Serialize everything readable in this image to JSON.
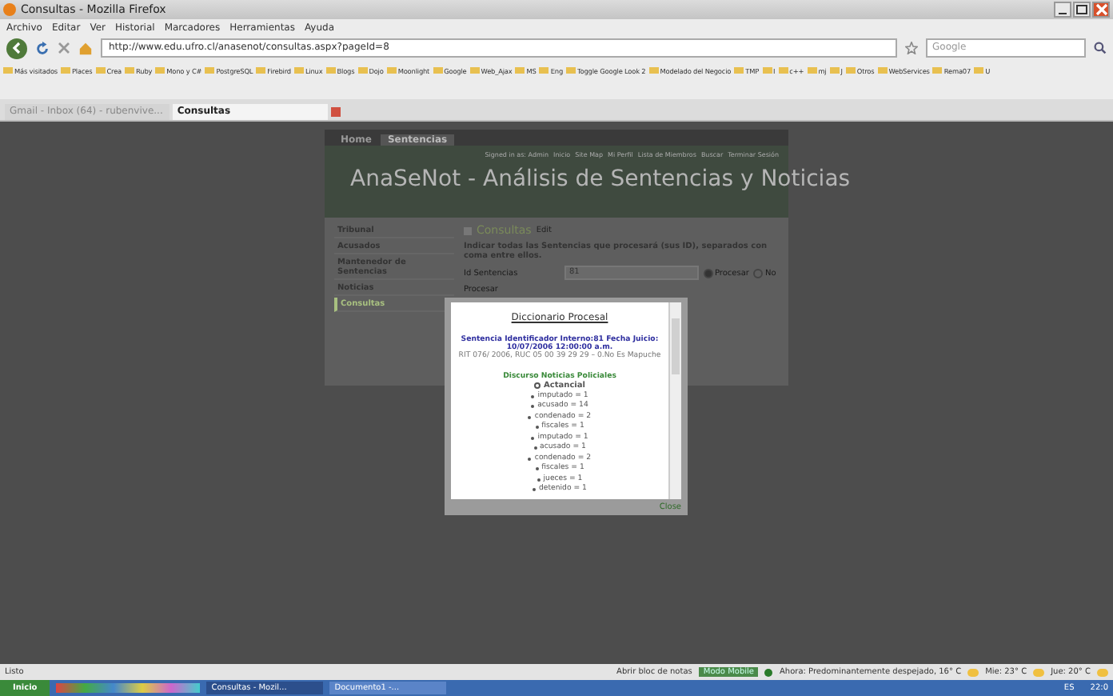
{
  "window": {
    "title": "Consultas - Mozilla Firefox"
  },
  "menu": [
    "Archivo",
    "Editar",
    "Ver",
    "Historial",
    "Marcadores",
    "Herramientas",
    "Ayuda"
  ],
  "toolbar": {
    "url": "http://www.edu.ufro.cl/anasenot/consultas.aspx?pageId=8",
    "search_placeholder": "Google"
  },
  "bookmarks": [
    "Más visitados",
    "Places",
    "Crea",
    "Ruby",
    "Mono y C#",
    "PostgreSQL",
    "Firebird",
    "Linux",
    "Blogs",
    "Dojo",
    "Moonlight",
    "Google",
    "Web_Ajax",
    "MS",
    "Eng",
    "Toggle Google Look 2",
    "Modelado del Negocio",
    "TMP",
    "I",
    "c++",
    "mj",
    "J",
    "Otros",
    "WebServices",
    "Rema07",
    "U"
  ],
  "tabs": [
    {
      "label": "Gmail - Inbox (64) - rubenvive...",
      "selected": false
    },
    {
      "label": "Consultas",
      "selected": true
    }
  ],
  "page": {
    "nav_tabs": [
      {
        "label": "Home",
        "selected": false
      },
      {
        "label": "Sentencias",
        "selected": true
      }
    ],
    "top_links": [
      "Signed in as: Admin",
      "Inicio",
      "Site Map",
      "Mi Perfil",
      "Lista de Miembros",
      "Buscar",
      "Terminar Sesión"
    ],
    "banner_title": "AnaSeNot - Análisis de Sentencias y Noticias",
    "sidebar": [
      {
        "label": "Tribunal",
        "selected": false
      },
      {
        "label": "Acusados",
        "selected": false
      },
      {
        "label": "Mantenedor de Sentencias",
        "selected": false
      },
      {
        "label": "Noticias",
        "selected": false
      },
      {
        "label": "Consultas",
        "selected": true
      }
    ],
    "heading": "Consultas",
    "edit_link": "Edit",
    "instruction": "Indicar todas las Sentencias que procesará (sus ID), separados con coma entre ellos.",
    "field_label": "Id Sentencias",
    "field_value": "81",
    "radios": [
      {
        "label": "Procesar",
        "selected": true
      },
      {
        "label": "No",
        "selected": false
      }
    ],
    "second_label": "Procesar"
  },
  "dialog": {
    "title": "Diccionario Procesal",
    "heading": "Sentencia Identificador Interno:81 Fecha Juicio: 10/07/2006 12:00:00 a.m.",
    "detail": "RIT 076/ 2006, RUC 05 00 39 29 29 – 0.No Es Mapuche",
    "section": "Discurso Noticias Policiales",
    "tree": [
      {
        "label": "Actancial",
        "children": [
          {
            "label": "imputado = 1"
          },
          {
            "label": "acusado = 14"
          },
          {
            "label": "condenado = 2"
          },
          {
            "label": "fiscales = 1"
          },
          {
            "label": "imputado = 1"
          },
          {
            "label": "acusado = 1"
          },
          {
            "label": "condenado = 2"
          },
          {
            "label": "fiscales = 1"
          },
          {
            "label": "jueces = 1"
          },
          {
            "label": "detenido = 1"
          }
        ]
      }
    ],
    "close": "Close"
  },
  "status_bar": {
    "text": "Listo",
    "notes": "Abrir bloc de notas",
    "mode": "Modo Mobile",
    "weather": [
      "Ahora: Predominantemente despejado, 16° C",
      "Mie: 23° C",
      "Jue: 20° C"
    ]
  },
  "taskbar": {
    "start": "Inicio",
    "windows": [
      {
        "label": "Consultas - Mozil...",
        "selected": true
      },
      {
        "label": "Documento1 -...",
        "selected": false
      }
    ],
    "lang": "ES",
    "clock": "22:0"
  }
}
